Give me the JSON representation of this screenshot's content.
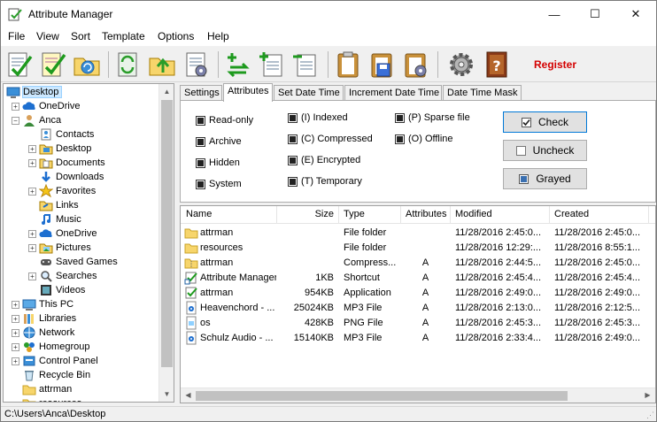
{
  "window": {
    "title": "Attribute Manager",
    "min": "—",
    "max": "☐",
    "close": "✕"
  },
  "menu": [
    "File",
    "View",
    "Sort",
    "Template",
    "Options",
    "Help"
  ],
  "toolbar": {
    "register": "Register"
  },
  "tree": {
    "items": [
      {
        "label": "Desktop",
        "icon": "desktop-icon",
        "expander": ""
      },
      {
        "label": "OneDrive",
        "icon": "onedrive-icon",
        "expander": "+"
      },
      {
        "label": "Anca",
        "icon": "user-icon",
        "expander": "−"
      },
      {
        "label": "Contacts",
        "icon": "contacts-icon",
        "expander": ""
      },
      {
        "label": "Desktop",
        "icon": "desktop-folder-icon",
        "expander": "+"
      },
      {
        "label": "Documents",
        "icon": "documents-icon",
        "expander": "+"
      },
      {
        "label": "Downloads",
        "icon": "downloads-icon",
        "expander": ""
      },
      {
        "label": "Favorites",
        "icon": "star-icon",
        "expander": "+"
      },
      {
        "label": "Links",
        "icon": "links-icon",
        "expander": ""
      },
      {
        "label": "Music",
        "icon": "music-icon",
        "expander": ""
      },
      {
        "label": "OneDrive",
        "icon": "onedrive-icon",
        "expander": "+"
      },
      {
        "label": "Pictures",
        "icon": "pictures-icon",
        "expander": "+"
      },
      {
        "label": "Saved Games",
        "icon": "saved-games-icon",
        "expander": ""
      },
      {
        "label": "Searches",
        "icon": "search-icon",
        "expander": "+"
      },
      {
        "label": "Videos",
        "icon": "videos-icon",
        "expander": ""
      },
      {
        "label": "This PC",
        "icon": "computer-icon",
        "expander": "+"
      },
      {
        "label": "Libraries",
        "icon": "libraries-icon",
        "expander": "+"
      },
      {
        "label": "Network",
        "icon": "network-icon",
        "expander": "+"
      },
      {
        "label": "Homegroup",
        "icon": "homegroup-icon",
        "expander": "+"
      },
      {
        "label": "Control Panel",
        "icon": "control-panel-icon",
        "expander": "+"
      },
      {
        "label": "Recycle Bin",
        "icon": "recycle-bin-icon",
        "expander": ""
      },
      {
        "label": "attrman",
        "icon": "folder-icon",
        "expander": ""
      },
      {
        "label": "resources",
        "icon": "folder-icon",
        "expander": ""
      }
    ]
  },
  "tabs": [
    "Settings",
    "Attributes",
    "Set Date Time",
    "Increment Date Time",
    "Date Time Mask"
  ],
  "attributes": {
    "col1": [
      "Read-only",
      "Archive",
      "Hidden",
      "System"
    ],
    "col2": [
      "(I) Indexed",
      "(C) Compressed",
      "(E) Encrypted",
      "(T) Temporary"
    ],
    "col3": [
      "(P) Sparse file",
      "(O) Offline"
    ],
    "buttons": {
      "check": "Check",
      "uncheck": "Uncheck",
      "grayed": "Grayed"
    }
  },
  "filelist": {
    "columns": [
      "Name",
      "Size",
      "Type",
      "Attributes",
      "Modified",
      "Created"
    ],
    "rows": [
      {
        "name": "attrman",
        "size": "",
        "type": "File folder",
        "attr": "",
        "modified": "11/28/2016 2:45:0...",
        "created": "11/28/2016 2:45:0...",
        "icon": "folder-icon"
      },
      {
        "name": "resources",
        "size": "",
        "type": "File folder",
        "attr": "",
        "modified": "11/28/2016 12:29:...",
        "created": "11/28/2016 8:55:1...",
        "icon": "folder-icon"
      },
      {
        "name": "attrman",
        "size": "",
        "type": "Compress...",
        "attr": "A",
        "modified": "11/28/2016 2:44:5...",
        "created": "11/28/2016 2:45:0...",
        "icon": "zip-folder-icon"
      },
      {
        "name": "Attribute Manager",
        "size": "1KB",
        "type": "Shortcut",
        "attr": "A",
        "modified": "11/28/2016 2:45:4...",
        "created": "11/28/2016 2:45:4...",
        "icon": "shortcut-icon"
      },
      {
        "name": "attrman",
        "size": "954KB",
        "type": "Application",
        "attr": "A",
        "modified": "11/28/2016 2:49:0...",
        "created": "11/28/2016 2:49:0...",
        "icon": "application-icon"
      },
      {
        "name": "Heavenchord - ...",
        "size": "25024KB",
        "type": "MP3 File",
        "attr": "A",
        "modified": "11/28/2016 2:13:0...",
        "created": "11/28/2016 2:12:5...",
        "icon": "mp3-icon"
      },
      {
        "name": "os",
        "size": "428KB",
        "type": "PNG File",
        "attr": "A",
        "modified": "11/28/2016 2:45:3...",
        "created": "11/28/2016 2:45:3...",
        "icon": "png-icon"
      },
      {
        "name": "Schulz Audio - ...",
        "size": "15140KB",
        "type": "MP3 File",
        "attr": "A",
        "modified": "11/28/2016 2:33:4...",
        "created": "11/28/2016 2:49:0...",
        "icon": "mp3-icon"
      }
    ]
  },
  "status": {
    "path": "C:\\Users\\Anca\\Desktop"
  },
  "colors": {
    "accent": "#0078d7",
    "register": "#d40000",
    "selection": "#cce8ff",
    "folder": "#f7d56b"
  }
}
